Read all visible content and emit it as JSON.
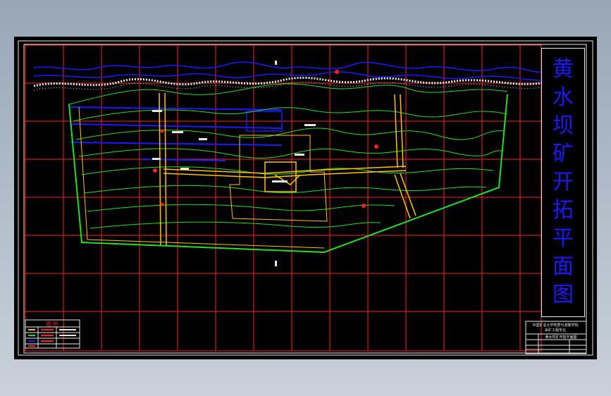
{
  "drawing": {
    "title_chars": [
      "黄",
      "水",
      "坝",
      "矿",
      "开",
      "拓",
      "平",
      "面",
      "图"
    ],
    "legend_title": "图 例",
    "info_line_1": "中国矿业大学地质与测量学院",
    "info_line_2": "采矿工程专业",
    "info_line_3": "黄水坝矿开拓平面图",
    "colors": {
      "background": "#000000",
      "grid": "#ff2020",
      "contour": "#22e022",
      "roadway": "#ffc400",
      "water": "#1a1aff",
      "border": "#e8e8e8",
      "title": "#1a1aff"
    }
  }
}
